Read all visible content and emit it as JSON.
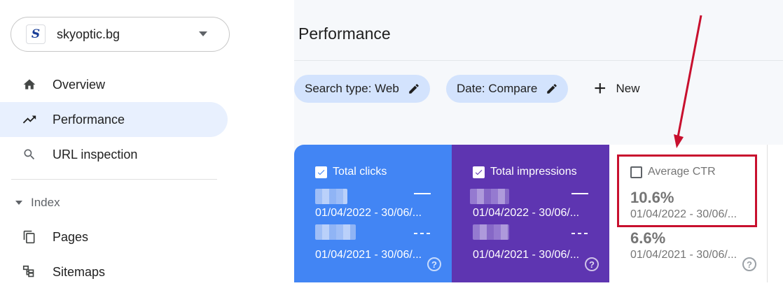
{
  "property": {
    "logo_letter": "S",
    "name": "skyoptic.bg"
  },
  "sidebar": {
    "items": [
      {
        "label": "Overview",
        "icon": "home-icon"
      },
      {
        "label": "Performance",
        "icon": "trending-up-icon"
      },
      {
        "label": "URL inspection",
        "icon": "search-icon"
      }
    ],
    "section": {
      "label": "Index"
    },
    "index_items": [
      {
        "label": "Pages",
        "icon": "pages-icon"
      },
      {
        "label": "Sitemaps",
        "icon": "sitemap-icon"
      }
    ]
  },
  "main": {
    "title": "Performance",
    "filters": [
      {
        "label": "Search type: Web"
      },
      {
        "label": "Date: Compare"
      }
    ],
    "new_label": "New"
  },
  "cards": {
    "clicks": {
      "label": "Total clicks",
      "date1": "01/04/2022 - 30/06/...",
      "date2": "01/04/2021 - 30/06/...",
      "help": "?"
    },
    "impressions": {
      "label": "Total impressions",
      "date1": "01/04/2022 - 30/06/...",
      "date2": "01/04/2021 - 30/06/...",
      "help": "?"
    },
    "ctr": {
      "label": "Average CTR",
      "value1": "10.6%",
      "date1": "01/04/2022 - 30/06/...",
      "value2": "6.6%",
      "date2": "01/04/2021 - 30/06/...",
      "help": "?"
    }
  },
  "colors": {
    "clicks": "#4285f4",
    "impressions": "#5e35b1",
    "highlight": "#c8102e",
    "active_nav": "#e8f0fe",
    "chip": "#d3e3fd"
  }
}
